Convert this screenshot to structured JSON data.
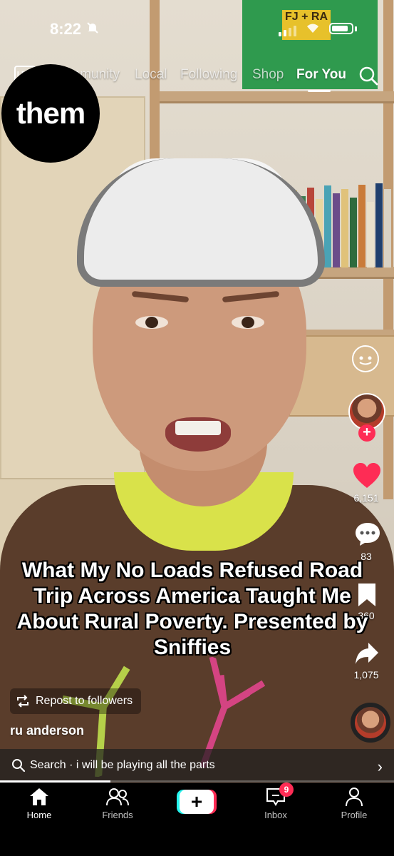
{
  "status_bar": {
    "time": "8:22"
  },
  "top_nav": {
    "live_label": "LIVE",
    "tabs": [
      "Community",
      "Local",
      "Following",
      "Shop",
      "For You"
    ],
    "active_tab": "For You"
  },
  "channel_logo": "them",
  "video": {
    "caption": "What My No Loads Refused Road Trip Across America Taught Me About Rural Poverty. Presented by Sniffies",
    "background_text": "FJ + RA",
    "author": "ru anderson",
    "repost_label": "Repost to followers",
    "progress_fraction": 0.28
  },
  "actions": {
    "likes": "6,151",
    "comments": "83",
    "saves": "360",
    "shares": "1,075"
  },
  "search_bar": {
    "text": "Search · i will be playing all the parts"
  },
  "tab_bar": {
    "items": [
      "Home",
      "Friends",
      "",
      "Inbox",
      "Profile"
    ],
    "inbox_badge": "9"
  },
  "colors": {
    "accent": "#fe2c55",
    "cyan": "#25f4ee"
  }
}
